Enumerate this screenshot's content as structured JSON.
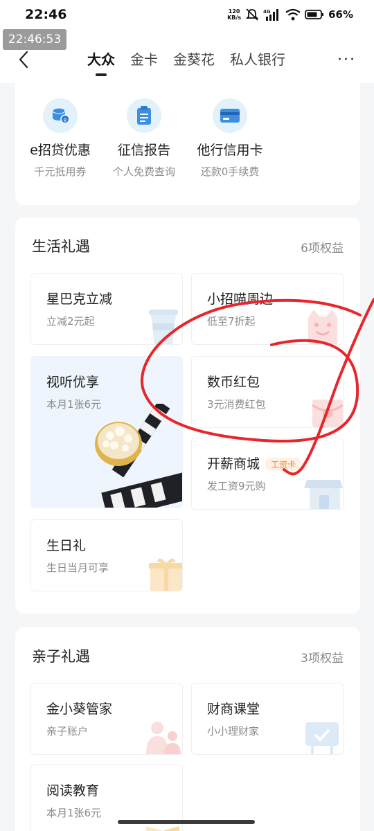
{
  "status_bar": {
    "time": "22:46",
    "net_speed": "120",
    "net_unit": "KB/s",
    "network": "4G",
    "battery": "66%"
  },
  "time_badge": "22:46:53",
  "nav": {
    "tabs": [
      "大众",
      "金卡",
      "金葵花",
      "私人银行"
    ],
    "active_tab": 0,
    "more_label": "···"
  },
  "services": [
    {
      "title": "e招贷优惠",
      "sub": "千元抵用券",
      "icon": "coins-icon"
    },
    {
      "title": "征信报告",
      "sub": "个人免费查询",
      "icon": "report-icon"
    },
    {
      "title": "他行信用卡",
      "sub": "还款0手续费",
      "icon": "credit-card-icon"
    }
  ],
  "life": {
    "title": "生活礼遇",
    "count": "6项权益",
    "tiles": [
      {
        "title": "星巴克立减",
        "sub": "立减2元起",
        "icon": "coffee-cup-icon"
      },
      {
        "title": "小招喵周边",
        "sub": "低至7折起",
        "icon": "cat-mascot-icon"
      },
      {
        "title": "视听优享",
        "sub": "本月1张6元",
        "icon": "popcorn-clapper-icon"
      },
      {
        "title": "数币红包",
        "sub": "3元消费红包",
        "icon": "red-envelope-icon"
      },
      {
        "title": "开薪商城",
        "sub": "发工资9元购",
        "tag": "工资卡",
        "icon": "shop-icon"
      },
      {
        "title": "生日礼",
        "sub": "生日当月可享",
        "icon": "gift-icon"
      }
    ]
  },
  "family": {
    "title": "亲子礼遇",
    "count": "3项权益",
    "tiles": [
      {
        "title": "金小葵管家",
        "sub": "亲子账户",
        "icon": "family-icon"
      },
      {
        "title": "财商课堂",
        "sub": "小小理财家",
        "icon": "classroom-icon"
      },
      {
        "title": "阅读教育",
        "sub": "本月1张6元",
        "icon": "book-icon"
      }
    ]
  },
  "colors": {
    "accent_blue": "#3e8ee0",
    "annotation_red": "#e8252a",
    "tag_orange": "#e98b3c"
  }
}
